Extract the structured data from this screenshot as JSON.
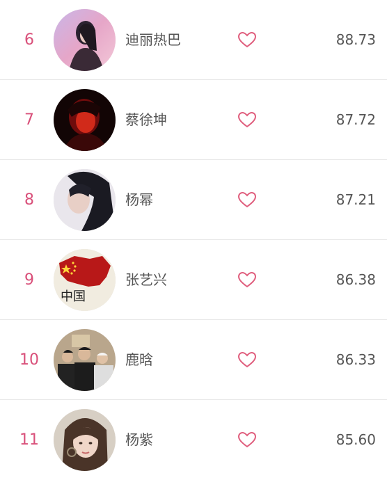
{
  "colors": {
    "rank": "#d9507a",
    "heart": "#e0607f",
    "text": "#555555",
    "divider": "#e8e8e8"
  },
  "rows": [
    {
      "rank": "6",
      "name": "迪丽热巴",
      "score": "88.73",
      "icon": "heart-outline-icon"
    },
    {
      "rank": "7",
      "name": "蔡徐坤",
      "score": "87.72",
      "icon": "heart-outline-icon"
    },
    {
      "rank": "8",
      "name": "杨幂",
      "score": "87.21",
      "icon": "heart-outline-icon"
    },
    {
      "rank": "9",
      "name": "张艺兴",
      "score": "86.38",
      "icon": "heart-outline-icon"
    },
    {
      "rank": "10",
      "name": "鹿晗",
      "score": "86.33",
      "icon": "heart-outline-icon"
    },
    {
      "rank": "11",
      "name": "杨紫",
      "score": "85.60",
      "icon": "heart-outline-icon"
    }
  ],
  "avatar_badge": {
    "text": "中国"
  }
}
